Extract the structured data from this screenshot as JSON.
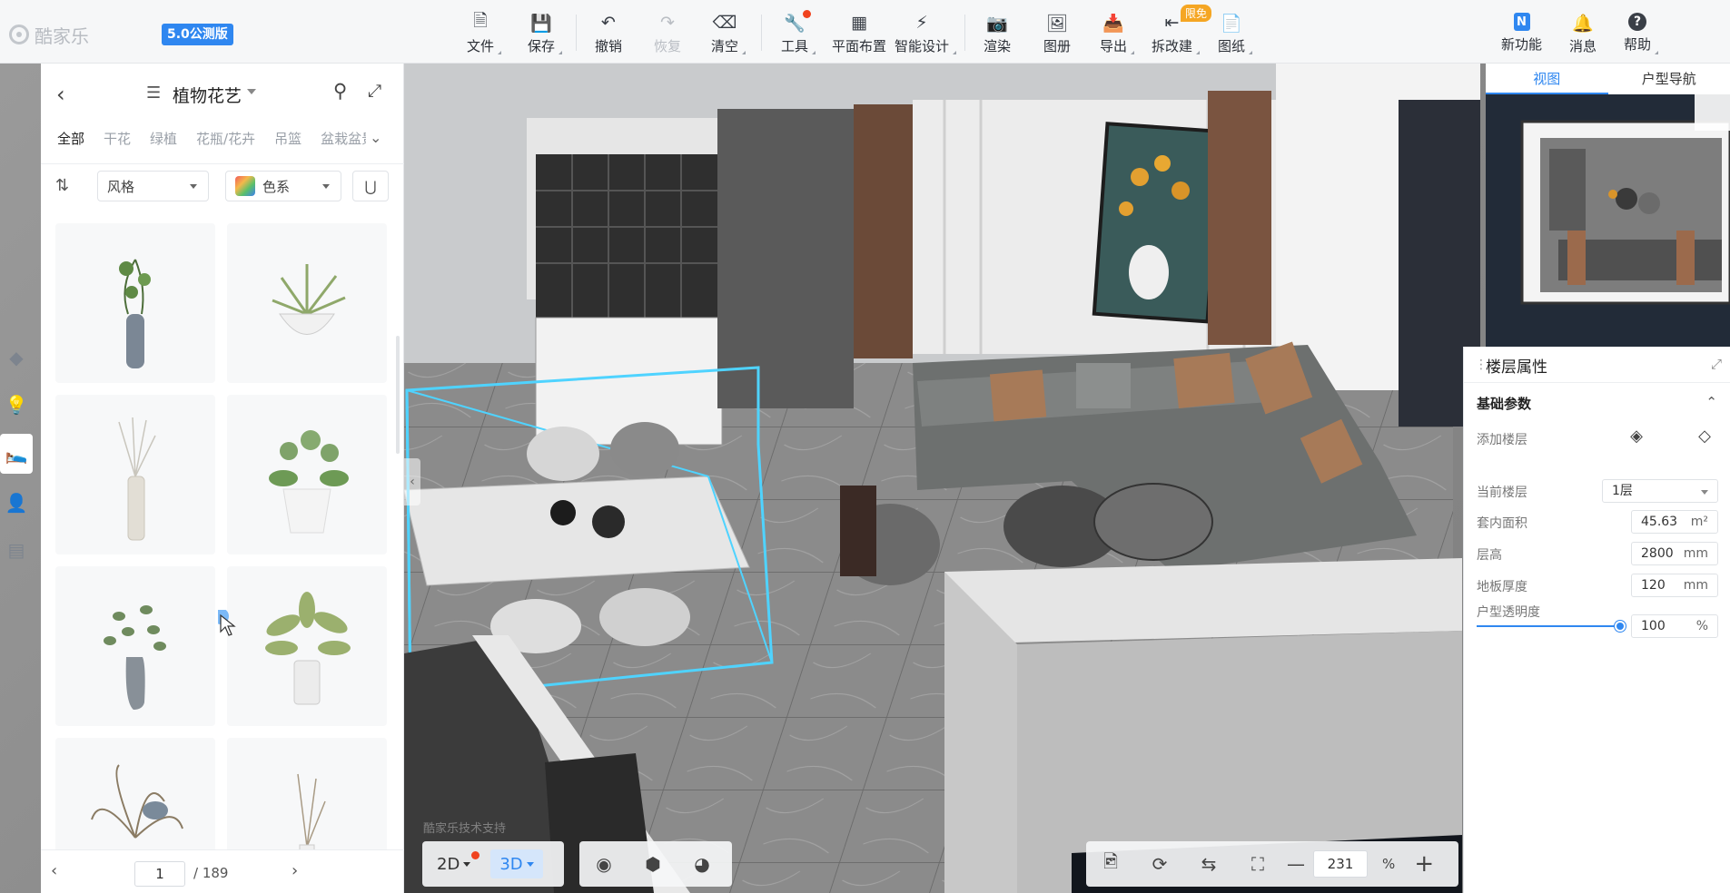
{
  "app": {
    "logo_text": "酷家乐",
    "version_badge": "5.0公测版"
  },
  "toolbar": {
    "items": [
      {
        "label": "文件",
        "icon": "file-icon"
      },
      {
        "label": "保存",
        "icon": "save-icon"
      },
      {
        "label": "撤销",
        "icon": "undo-icon"
      },
      {
        "label": "恢复",
        "icon": "redo-icon",
        "disabled": true
      },
      {
        "label": "清空",
        "icon": "eraser-icon"
      },
      {
        "label": "工具",
        "icon": "wrench-icon",
        "has_notification": true
      },
      {
        "label": "平面布置",
        "icon": "layout-icon"
      },
      {
        "label": "智能设计",
        "icon": "lightning-icon"
      },
      {
        "label": "渲染",
        "icon": "camera-icon"
      },
      {
        "label": "图册",
        "icon": "album-icon"
      },
      {
        "label": "导出",
        "icon": "export-icon"
      },
      {
        "label": "拆改建",
        "icon": "rebuild-icon",
        "badge": "限免"
      },
      {
        "label": "图纸",
        "icon": "drawing-icon"
      },
      {
        "label": "新功能",
        "icon": "new-feature-icon"
      },
      {
        "label": "消息",
        "icon": "bell-icon"
      },
      {
        "label": "帮助",
        "icon": "help-icon"
      }
    ]
  },
  "catalog": {
    "title": "植物花艺",
    "tabs": [
      "全部",
      "干花",
      "绿植",
      "花瓶/花卉",
      "吊篮",
      "盆栽盆景"
    ],
    "active_tab": "全部",
    "filters": {
      "style_label": "风格",
      "color_label": "色系"
    },
    "pagination": {
      "current": "1",
      "total": "/ 189"
    }
  },
  "right_panel": {
    "tabs": [
      "视图",
      "户型导航"
    ],
    "active_tab": "视图",
    "props_title": "楼层属性",
    "section_title": "基础参数",
    "rows": {
      "add_floor": "添加楼层",
      "current_floor": "当前楼层",
      "current_floor_value": "1层",
      "inner_area": "套内面积",
      "inner_area_value": "45.63",
      "inner_area_unit": "m²",
      "floor_height": "层高",
      "floor_height_value": "2800",
      "floor_height_unit": "mm",
      "slab_thickness": "地板厚度",
      "slab_thickness_value": "120",
      "slab_thickness_unit": "mm",
      "transparency": "户型透明度",
      "transparency_value": "100",
      "transparency_unit": "%"
    },
    "transparency_fraction": 1.0
  },
  "bottom": {
    "mode_2d": "2D",
    "mode_3d": "3D",
    "zoom_value": "231",
    "zoom_unit": "%",
    "watermark": "酷家乐技术支持"
  },
  "colors": {
    "accent": "#2f87f0",
    "notification": "#f0431e",
    "limit_badge": "#f5a623"
  }
}
